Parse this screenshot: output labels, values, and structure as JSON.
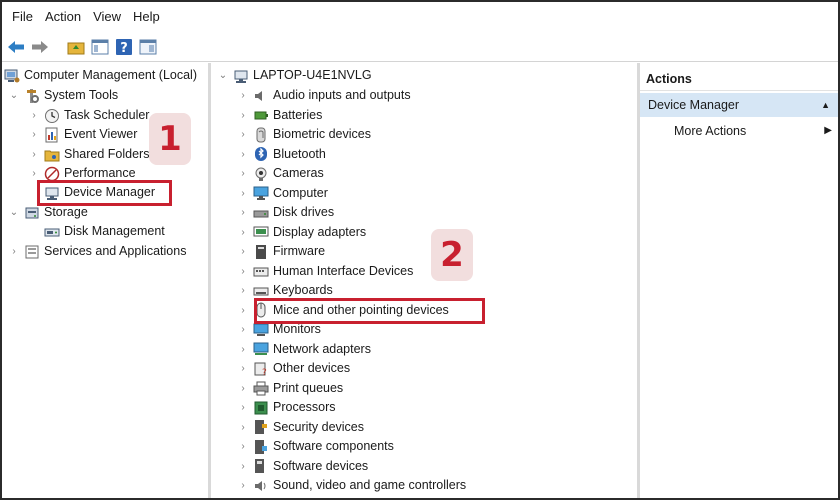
{
  "menu": [
    "File",
    "Action",
    "View",
    "Help"
  ],
  "left_tree": {
    "root": "Computer Management (Local)",
    "system_tools": "System Tools",
    "task_scheduler": "Task Scheduler",
    "event_viewer": "Event Viewer",
    "shared_folders": "Shared Folders",
    "performance": "Performance",
    "device_manager": "Device Manager",
    "storage": "Storage",
    "disk_management": "Disk Management",
    "services": "Services and Applications"
  },
  "device_tree": {
    "root": "LAPTOP-U4E1NVLG",
    "items": [
      "Audio inputs and outputs",
      "Batteries",
      "Biometric devices",
      "Bluetooth",
      "Cameras",
      "Computer",
      "Disk drives",
      "Display adapters",
      "Firmware",
      "Human Interface Devices",
      "Keyboards",
      "Mice and other pointing devices",
      "Monitors",
      "Network adapters",
      "Other devices",
      "Print queues",
      "Processors",
      "Security devices",
      "Software components",
      "Software devices",
      "Sound, video and game controllers"
    ]
  },
  "actions": {
    "header": "Actions",
    "selected": "Device Manager",
    "more": "More Actions"
  },
  "badges": {
    "one": "1",
    "two": "2"
  },
  "colors": {
    "highlight": "#c8202f",
    "badge_bg": "#f2dede",
    "selected_bg": "#d6e6f5"
  }
}
